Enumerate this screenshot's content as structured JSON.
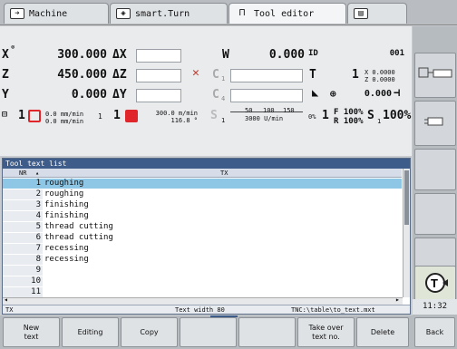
{
  "tabs": [
    {
      "label": "Machine",
      "icon": "machine-mode-icon"
    },
    {
      "label": "smart.Turn",
      "icon": "smart-turn-icon"
    },
    {
      "label": "Tool editor",
      "icon": "tool-editor-icon"
    },
    {
      "label": "",
      "icon": "save-icon"
    }
  ],
  "status": {
    "x_label": "X",
    "x_value": "300.000",
    "dx_label": "ΔX",
    "z_label": "Z",
    "z_value": "450.000",
    "dz_label": "ΔZ",
    "y_label": "Y",
    "y_value": "0.000",
    "dy_label": "ΔY",
    "w_label": "W",
    "w_value": "0.000",
    "id_label": "ID",
    "id_value": "001",
    "c1_label": "C",
    "c1_sub": "1",
    "c4_label": "C",
    "c4_sub": "4",
    "t_label": "T",
    "t_value": "1",
    "t_x": "X  0.0000",
    "t_z": "Z  0.0000",
    "tool_offset_value": "0.000",
    "feed1": "0.0 mm/min",
    "feed2": "0.0 mm/min",
    "spindle_num_a": "1",
    "spindle_idx_a": "1",
    "spindle_num_b": "1",
    "speed1": "300.0 m/min",
    "speed2": "116.8 °",
    "s_label": "S",
    "s_sub": "1",
    "s_bar_value": "3000 U/min",
    "s_percent_label": "0%",
    "f_override": "F 100%",
    "r_override": "R 100%",
    "channel": "1",
    "s1_label": "S",
    "s1_sub": "1",
    "s1_override": "100%",
    "spindle_ticks": [
      "50",
      "100",
      "150"
    ]
  },
  "window": {
    "title": "Tool text list",
    "col_nr": "NR",
    "col_tx": "TX",
    "rows": [
      {
        "nr": "1",
        "tx": "roughing"
      },
      {
        "nr": "2",
        "tx": "roughing"
      },
      {
        "nr": "3",
        "tx": "finishing"
      },
      {
        "nr": "4",
        "tx": "finishing"
      },
      {
        "nr": "5",
        "tx": "thread cutting"
      },
      {
        "nr": "6",
        "tx": "thread cutting"
      },
      {
        "nr": "7",
        "tx": "recessing"
      },
      {
        "nr": "8",
        "tx": "recessing"
      },
      {
        "nr": "9",
        "tx": ""
      },
      {
        "nr": "10",
        "tx": ""
      },
      {
        "nr": "11",
        "tx": ""
      }
    ],
    "status_field": "TX",
    "status_width": "Text width 80",
    "status_path": "TNC:\\table\\to_text.mxt"
  },
  "softkeys": [
    "New\ntext",
    "Editing",
    "Copy",
    "",
    "",
    "Take over\ntext no.",
    "Delete",
    "Back"
  ],
  "clock": "11:32",
  "colors": {
    "selected_row": "#8ec7e6",
    "title_bar": "#3d5c8a",
    "red_accent": "#e0262b"
  }
}
